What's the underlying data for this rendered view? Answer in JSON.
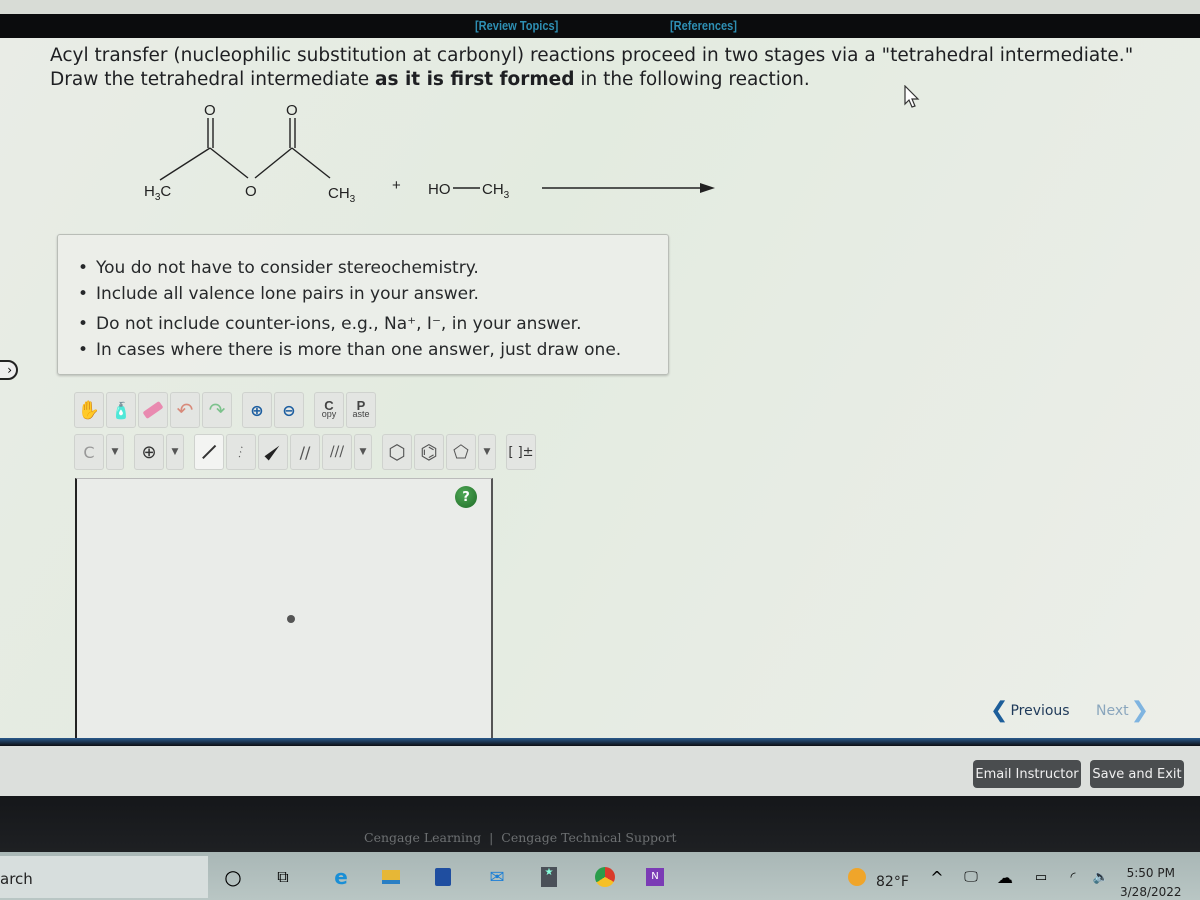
{
  "header": {
    "review_topics": "[Review Topics]",
    "references": "[References]"
  },
  "question": {
    "text_part1": "Acyl transfer (nucleophilic substitution at carbonyl) reactions proceed in two stages via a \"tetrahedral intermediate.\" Draw the tetrahedral intermediate ",
    "text_bold": "as it is first formed",
    "text_part2": " in the following reaction."
  },
  "reaction": {
    "reactant1_left": "H",
    "reactant1_left_sub": "3",
    "reactant1_left_c": "C",
    "bridge_o": "O",
    "carbonyl_o1": "O",
    "carbonyl_o2": "O",
    "reactant1_right": "CH",
    "reactant1_right_sub": "3",
    "plus": "+",
    "reactant2": "HO",
    "reactant2_right": "CH",
    "reactant2_right_sub": "3"
  },
  "notes": [
    "You do not have to consider stereochemistry.",
    "Include all valence lone pairs in your answer.",
    "Do not include counter-ions, e.g., Na⁺, I⁻, in your answer.",
    "In cases where there is more than one answer, just draw one."
  ],
  "toolbar": {
    "copy_top": "C",
    "copy_bottom": "opy",
    "paste_top": "P",
    "paste_bottom": "aste",
    "element_label": "C",
    "charge_label": "⊕",
    "bracket_label": "[ ]±",
    "help_label": "?"
  },
  "navigation": {
    "previous": "Previous",
    "next": "Next"
  },
  "actions": {
    "email_instructor": "Email Instructor",
    "save_and_exit": "Save and Exit"
  },
  "footer": {
    "link1": "Cengage Learning",
    "separator": "|",
    "link2": "Cengage Technical Support"
  },
  "taskbar": {
    "search_text": "arch",
    "temperature": "82°F",
    "time": "5:50 PM",
    "date": "3/28/2022"
  }
}
